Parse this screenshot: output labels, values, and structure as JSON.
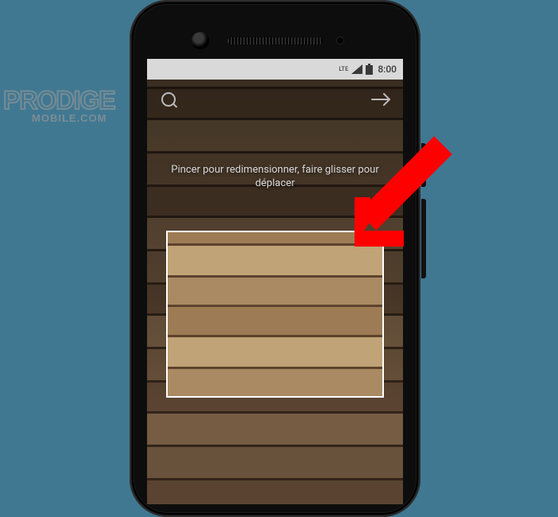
{
  "statusbar": {
    "network_label": "LTE",
    "time": "8:00"
  },
  "editor": {
    "hint": "Pincer pour redimensionner, faire glisser pour déplacer"
  },
  "watermark": {
    "line1": "PRODIGE",
    "line2": "MOBILE.COM"
  },
  "icons": {
    "back": "back-circle-icon",
    "forward": "arrow-right-icon",
    "signal": "signal-icon",
    "battery": "battery-icon"
  },
  "colors": {
    "page_bg": "#407892",
    "arrow": "#ff0000",
    "crop_border": "#ffffff"
  }
}
